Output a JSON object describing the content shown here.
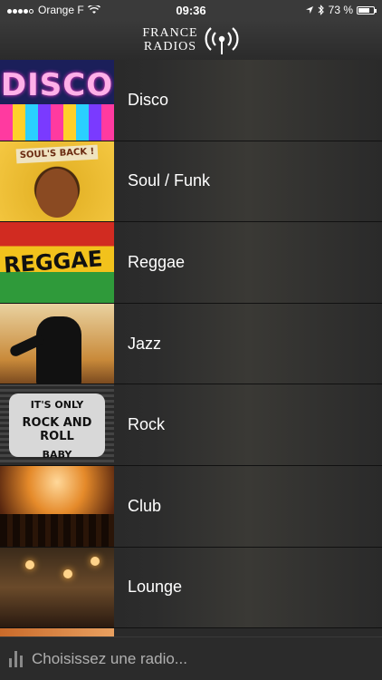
{
  "status_bar": {
    "carrier": "Orange F",
    "time": "09:36",
    "battery": "73 %",
    "battery_level": 0.73,
    "signal_dots": 4,
    "icons": [
      "wifi-icon",
      "location-arrow-icon",
      "bluetooth-icon",
      "battery-icon"
    ]
  },
  "header": {
    "logo_line1": "FRANCE",
    "logo_line2": "RADIOS",
    "logo_icon": "radio-antenna-icon"
  },
  "genres": [
    {
      "label": "Disco"
    },
    {
      "label": "Soul / Funk"
    },
    {
      "label": "Reggae"
    },
    {
      "label": "Jazz"
    },
    {
      "label": "Rock"
    },
    {
      "label": "Club"
    },
    {
      "label": "Lounge"
    }
  ],
  "thumbnails": {
    "disco_text": "DISCO",
    "soul_text": "SOUL'S BACK !",
    "reggae_text": "REGGAE",
    "rock_line1": "IT'S ONLY",
    "rock_line2": "ROCK AND ROLL",
    "rock_line3": "BABY"
  },
  "player": {
    "placeholder": "Choisissez une radio...",
    "icon": "equalizer-icon"
  }
}
